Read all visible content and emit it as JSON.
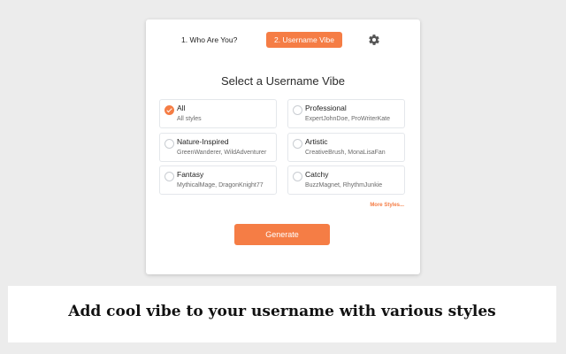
{
  "steps": {
    "step1_label": "1. Who Are You?",
    "step2_label": "2. Username Vibe",
    "settings_icon": "gear-icon"
  },
  "main": {
    "heading": "Select a Username Vibe",
    "options": [
      {
        "title": "All",
        "desc": "All styles",
        "selected": true
      },
      {
        "title": "Professional",
        "desc": "ExpertJohnDoe, ProWriterKate",
        "selected": false
      },
      {
        "title": "Nature-Inspired",
        "desc": "GreenWanderer, WildAdventurer",
        "selected": false
      },
      {
        "title": "Artistic",
        "desc": "CreativeBrush, MonaLisaFan",
        "selected": false
      },
      {
        "title": "Fantasy",
        "desc": "MythicalMage, DragonKnight77",
        "selected": false
      },
      {
        "title": "Catchy",
        "desc": "BuzzMagnet, RhythmJunkie",
        "selected": false
      }
    ],
    "more_link": "More Styles...",
    "generate_label": "Generate"
  },
  "banner": {
    "caption": "Add cool vibe to your username with various styles"
  },
  "colors": {
    "accent": "#f57d45",
    "background": "#ececec"
  }
}
